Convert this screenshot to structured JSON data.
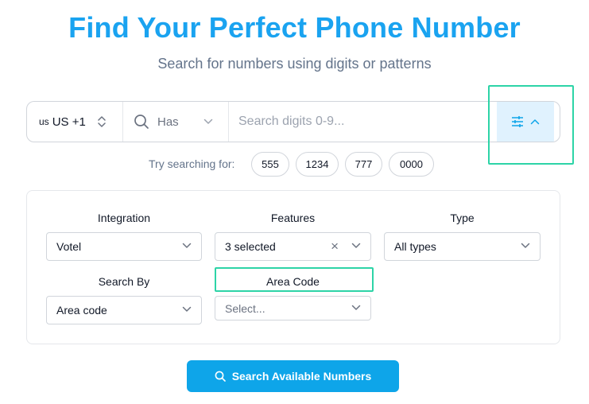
{
  "header": {
    "title": "Find Your Perfect Phone Number",
    "subtitle": "Search for numbers using digits or patterns"
  },
  "search": {
    "country_flag": "us",
    "country_code": "US +1",
    "match_mode": "Has",
    "placeholder": "Search digits 0-9..."
  },
  "suggestions": {
    "label": "Try searching for:",
    "chips": [
      "555",
      "1234",
      "777",
      "0000"
    ]
  },
  "filters": {
    "integration": {
      "label": "Integration",
      "value": "Votel"
    },
    "features": {
      "label": "Features",
      "value": "3 selected"
    },
    "type": {
      "label": "Type",
      "value": "All types"
    },
    "search_by": {
      "label": "Search By",
      "value": "Area code"
    },
    "area_code": {
      "label": "Area Code",
      "placeholder": "Select..."
    }
  },
  "actions": {
    "search_button": "Search Available Numbers"
  },
  "colors": {
    "title": "#1aa3f0",
    "accent": "#0ea5e9",
    "highlight": "#2dd4a7",
    "filter_button_bg": "#e0f2fe"
  },
  "icons": [
    "updown-icon",
    "search-icon",
    "chevron-down-icon",
    "sliders-icon",
    "chevron-up-icon",
    "clear-icon"
  ]
}
